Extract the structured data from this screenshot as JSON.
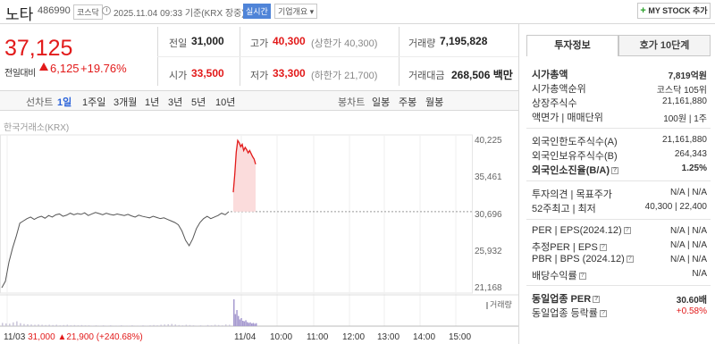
{
  "header": {
    "name": "노타",
    "code": "486990",
    "market": "코스닥",
    "datetime": "2025.11.04 09:33",
    "basis": "기준(KRX 장중)",
    "live_label": "실시간",
    "company_info_label": "기업개요 ▾",
    "my_stock_label": "MY STOCK 추가"
  },
  "price": {
    "current": "37,125",
    "prev_label": "전일대비",
    "change": "6,125",
    "change_pct": "+19.76%",
    "direction": "up"
  },
  "summary": {
    "prev_close_label": "전일",
    "prev_close": "31,000",
    "high_label": "고가",
    "high": "40,300",
    "upper_limit": "(상한가 40,300)",
    "volume_label": "거래량",
    "volume": "7,195,828",
    "open_label": "시가",
    "open": "33,500",
    "low_label": "저가",
    "low": "33,300",
    "lower_limit": "(하한가 21,700)",
    "amount_label": "거래대금",
    "amount": "268,506 백만"
  },
  "periods": {
    "label": "선차트",
    "items": [
      "1일",
      "1주일",
      "3개월",
      "1년",
      "3년",
      "5년",
      "10년"
    ],
    "selected": "1일",
    "candle_label": "봉차트",
    "candle_items": [
      "일봉",
      "주봉",
      "월봉"
    ]
  },
  "chart": {
    "exchange_label": "한국거래소(KRX)",
    "volume_label": "거래량",
    "x_info_date": "11/03",
    "x_info_price": "31,000",
    "x_info_change": "▲21,900 (+240.68%)"
  },
  "chart_data": {
    "type": "line",
    "title": "",
    "xlabel": "",
    "ylabel": "",
    "ylim": [
      21168,
      40225
    ],
    "y_ticks": [
      "40,225",
      "35,461",
      "30,696",
      "25,932",
      "21,168"
    ],
    "x_ticks": [
      "11/04",
      "10:00",
      "11:00",
      "12:00",
      "13:00",
      "14:00",
      "15:00"
    ],
    "reference_line": 31000,
    "series": [
      {
        "segment": "11/03",
        "color": "#555555",
        "values": [
          20000,
          22000,
          24500,
          26300,
          27800,
          29500,
          29800,
          30100,
          30300,
          30000,
          30250,
          30400,
          30150,
          30500,
          30300,
          30600,
          30700,
          30400,
          30550,
          30800,
          30600,
          30750,
          30650,
          30850,
          30500,
          30700,
          30900,
          30750,
          30600,
          30800,
          30650,
          30550,
          30700,
          30600,
          30500,
          30650,
          30450,
          30300,
          30550,
          30400,
          30300,
          30200,
          30400,
          30250,
          30100,
          30200,
          30000,
          29800,
          29600,
          29300,
          28500,
          27300,
          26600,
          27500,
          28800,
          29600,
          30100,
          30400,
          30100,
          30300,
          30500,
          30800,
          30600,
          31000
        ]
      },
      {
        "segment": "11/04",
        "color": "#e21a1a",
        "values": [
          33500,
          35800,
          38700,
          40200,
          39900,
          39400,
          39700,
          38900,
          39300,
          39000,
          38600,
          38900,
          38500,
          38100,
          37800,
          37125
        ]
      }
    ],
    "volume": {
      "day1": [
        12,
        10,
        9,
        14,
        18,
        11,
        8,
        7,
        6,
        5,
        6,
        5,
        4,
        5,
        4,
        5,
        3,
        4,
        5,
        3,
        4,
        3,
        4,
        3,
        3,
        2,
        3,
        2,
        3,
        2,
        3,
        2,
        2,
        3,
        2,
        2,
        3,
        2,
        2,
        3,
        2,
        3,
        4,
        3,
        5,
        6,
        7,
        8,
        6,
        4,
        3,
        5,
        4,
        3,
        2,
        3,
        2,
        4,
        3,
        5,
        4,
        3,
        6,
        5
      ],
      "day2": [
        100,
        45,
        60,
        38,
        25,
        30,
        20,
        18,
        22,
        15,
        12,
        14,
        10,
        12,
        9,
        11
      ]
    }
  },
  "panel": {
    "tabs": [
      "투자정보",
      "호가 10단계"
    ],
    "active_tab": "투자정보",
    "rows": [
      {
        "label": "시가총액",
        "value": "7,819억원",
        "bold": true
      },
      {
        "label": "시가총액순위",
        "value": "코스닥 105위"
      },
      {
        "label": "상장주식수",
        "value": "21,161,880"
      },
      {
        "label": "액면가 | 매매단위",
        "value": "100원 | 1주"
      },
      {
        "label": "외국인한도주식수(A)",
        "value": "21,161,880"
      },
      {
        "label": "외국인보유주식수(B)",
        "value": "264,343"
      },
      {
        "label": "외국인소진율(B/A)",
        "value": "1.25%",
        "bold": true,
        "help": true
      },
      {
        "label": "투자의견 | 목표주가",
        "value": "N/A | N/A"
      },
      {
        "label": "52주최고 | 최저",
        "value": "40,300 | 22,400"
      },
      {
        "label": "PER | EPS(2024.12)",
        "value": "N/A | N/A",
        "help": true
      },
      {
        "label": "추정PER | EPS",
        "value": "N/A | N/A",
        "help": true
      },
      {
        "label": "PBR | BPS (2024.12)",
        "value": "N/A | N/A",
        "help": true
      },
      {
        "label": "배당수익률",
        "value": "N/A",
        "help": true
      },
      {
        "label": "동일업종 PER",
        "value": "30.60배",
        "bold": true,
        "help": true
      },
      {
        "label": "동일업종 등락률",
        "value": "+0.58%",
        "red": true,
        "help": true
      }
    ]
  }
}
